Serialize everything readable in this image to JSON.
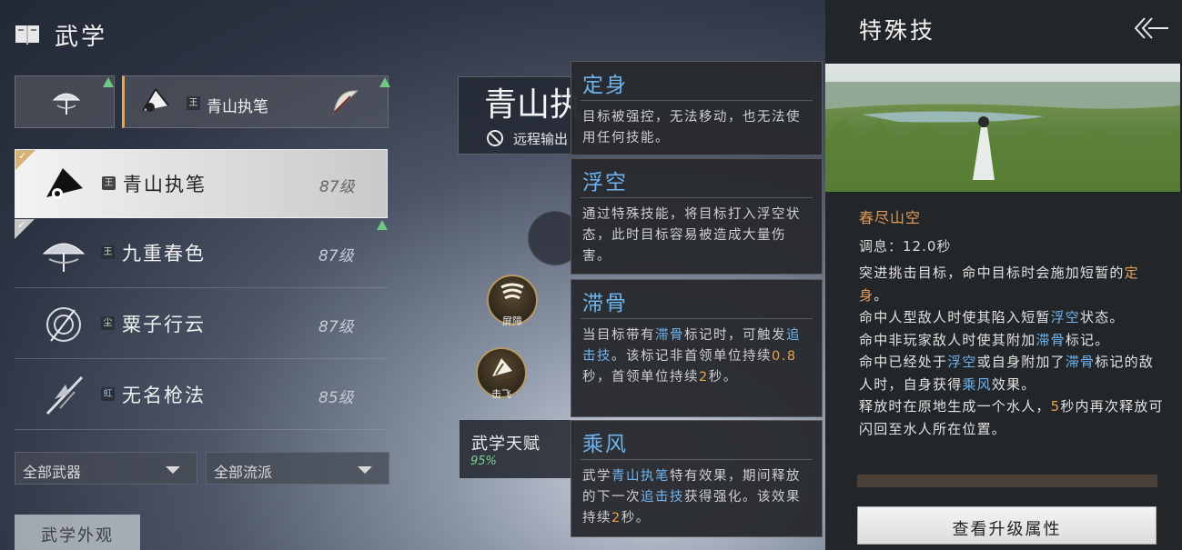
{
  "header": {
    "title": "武学",
    "icon": "book-icon"
  },
  "equipped": {
    "slot2_name": "青山执笔",
    "slot2_badge": "王"
  },
  "weapons": [
    {
      "name": "青山执笔",
      "level": "87级",
      "badge": "王",
      "icon": "fan-icon",
      "selected": true
    },
    {
      "name": "九重春色",
      "level": "87级",
      "badge": "王",
      "icon": "umbrella-icon",
      "selected": false
    },
    {
      "name": "粟子行云",
      "level": "87级",
      "badge": "尘",
      "icon": "spiral-icon",
      "selected": false
    },
    {
      "name": "无名枪法",
      "level": "85级",
      "badge": "虹",
      "icon": "spear-icon",
      "selected": false
    }
  ],
  "filters": {
    "weapon": "全部武器",
    "school": "全部流派"
  },
  "appearance_button": "武学外观",
  "middle": {
    "title": "青山执",
    "subtitle": "远程输出",
    "skills": [
      {
        "label": "屏障",
        "icon": "wind-icon"
      },
      {
        "label": "击飞",
        "icon": "fan-strike-icon"
      }
    ],
    "talent": {
      "label": "武学天赋",
      "percent": "95%"
    }
  },
  "tooltips": [
    {
      "title": "定身",
      "body": "目标被强控，无法移动，也无法使用任何技能。"
    },
    {
      "title": "浮空",
      "body": "通过特殊技能，将目标打入浮空状态，此时目标容易被造成大量伤害。"
    },
    {
      "title": "滞骨",
      "body_parts": [
        "当目标带有",
        "滞骨",
        "标记时，可触发",
        "追击技",
        "。该标记非首领单位持续",
        "0.8",
        "秒，首领单位持续",
        "2",
        "秒。"
      ]
    },
    {
      "title": "乘风",
      "body_parts": [
        "武学",
        "青山执笔",
        "特有效果，期间释放的下一次",
        "追击技",
        "获得强化。该效果持续",
        "2",
        "秒。"
      ]
    }
  ],
  "panel": {
    "title": "特殊技",
    "back_icon": "double-chevron-left-icon",
    "skill_name": "春尽山空",
    "cooldown": "调息：12.0秒",
    "desc": {
      "l1a": "突进挑击目标，命中目标时会施加短暂的",
      "l1k": "定身",
      "l1b": "。",
      "l2a": "命中人型敌人时使其陷入短暂",
      "l2k": "浮空",
      "l2b": "状态。",
      "l3a": "命中非玩家敌人时使其附加",
      "l3k": "滞骨",
      "l3b": "标记。",
      "l4a": "命中已经处于",
      "l4k1": "浮空",
      "l4b": "或自身附加了",
      "l4k2": "滞骨",
      "l4c": "标记的敌人时，自身获得",
      "l4k3": "乘风",
      "l4d": "效果。",
      "l5a": "释放时在原地生成一个水人，",
      "l5n": "5",
      "l5b": "秒内再次释放可闪回至水人所在位置。"
    },
    "upgrade_button": "查看升级属性"
  },
  "colors": {
    "accent_blue": "#6fb4ee",
    "accent_orange": "#e8a24a",
    "level_green": "#6fc883"
  }
}
